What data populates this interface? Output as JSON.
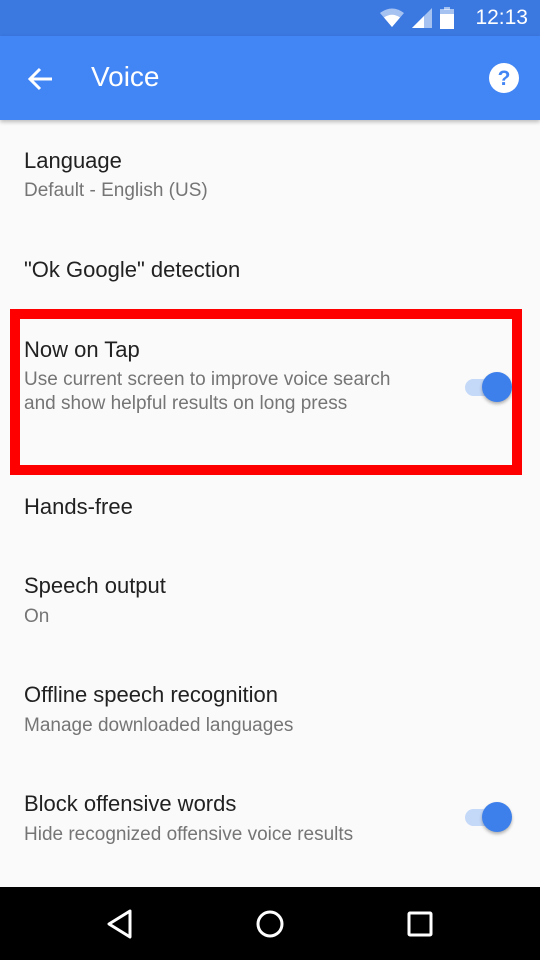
{
  "status_bar": {
    "time": "12:13",
    "icons": [
      "wifi-icon",
      "cellular-signal-icon",
      "battery-icon"
    ]
  },
  "app_bar": {
    "back_icon": "arrow-left-icon",
    "title": "Voice",
    "help_icon": "help-circle-icon"
  },
  "settings": [
    {
      "title": "Language",
      "subtitle": "Default - English (US)"
    },
    {
      "title": "\"Ok Google\" detection"
    },
    {
      "title": "Now on Tap",
      "subtitle": "Use current screen to improve voice search and show helpful results on long press",
      "toggle": true,
      "highlighted": true
    },
    {
      "title": "Hands-free"
    },
    {
      "title": "Speech output",
      "subtitle": "On"
    },
    {
      "title": "Offline speech recognition",
      "subtitle": "Manage downloaded languages"
    },
    {
      "title": "Block offensive words",
      "subtitle": "Hide recognized offensive voice results",
      "toggle": true
    }
  ],
  "nav_bar": {
    "buttons": [
      "back-triangle-icon",
      "home-circle-icon",
      "recents-square-icon"
    ]
  },
  "colors": {
    "app_bar": "#4285f4",
    "status_bar": "#3b78e0",
    "toggle_on": "#3d80ec",
    "highlight_box": "#ff0000"
  }
}
